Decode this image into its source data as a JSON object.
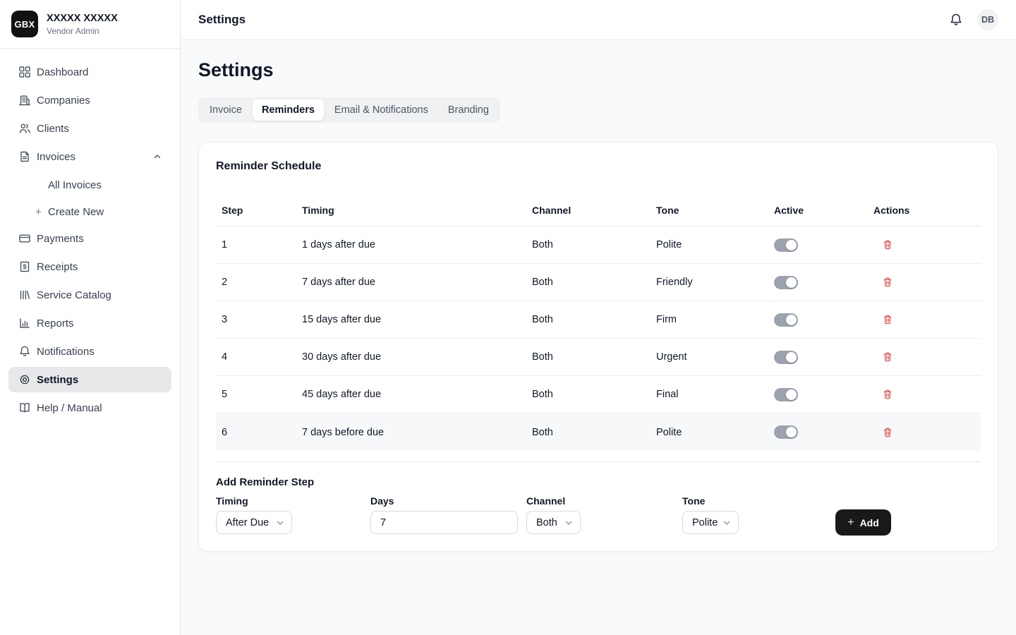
{
  "brand": {
    "logo": "GBX",
    "name": "XXXXX XXXXX",
    "subtitle": "Vendor Admin"
  },
  "topbar": {
    "title": "Settings",
    "avatar_initials": "DB"
  },
  "sidebar": {
    "items": [
      {
        "label": "Dashboard",
        "icon": "dashboard-icon",
        "active": false
      },
      {
        "label": "Companies",
        "icon": "companies-icon",
        "active": false
      },
      {
        "label": "Clients",
        "icon": "clients-icon",
        "active": false
      },
      {
        "label": "Invoices",
        "icon": "invoices-icon",
        "active": false,
        "expanded": true
      },
      {
        "label": "Payments",
        "icon": "payments-icon",
        "active": false
      },
      {
        "label": "Receipts",
        "icon": "receipts-icon",
        "active": false
      },
      {
        "label": "Service Catalog",
        "icon": "service-catalog-icon",
        "active": false
      },
      {
        "label": "Reports",
        "icon": "reports-icon",
        "active": false
      },
      {
        "label": "Notifications",
        "icon": "notifications-icon",
        "active": false
      },
      {
        "label": "Settings",
        "icon": "settings-icon",
        "active": true
      },
      {
        "label": "Help / Manual",
        "icon": "help-icon",
        "active": false
      }
    ],
    "invoices_submenu": [
      "All Invoices",
      "Create New"
    ]
  },
  "page": {
    "title": "Settings"
  },
  "tabs": [
    {
      "label": "Invoice",
      "active": false
    },
    {
      "label": "Reminders",
      "active": true
    },
    {
      "label": "Email & Notifications",
      "active": false
    },
    {
      "label": "Branding",
      "active": false
    }
  ],
  "reminder_schedule": {
    "title": "Reminder Schedule",
    "columns": [
      "Step",
      "Timing",
      "Channel",
      "Tone",
      "Active",
      "Actions"
    ],
    "rows": [
      {
        "step": "1",
        "timing": "1 days after due",
        "channel": "Both",
        "tone": "Polite",
        "active": true,
        "highlighted": false
      },
      {
        "step": "2",
        "timing": "7 days after due",
        "channel": "Both",
        "tone": "Friendly",
        "active": true,
        "highlighted": false
      },
      {
        "step": "3",
        "timing": "15 days after due",
        "channel": "Both",
        "tone": "Firm",
        "active": true,
        "highlighted": false
      },
      {
        "step": "4",
        "timing": "30 days after due",
        "channel": "Both",
        "tone": "Urgent",
        "active": true,
        "highlighted": false
      },
      {
        "step": "5",
        "timing": "45 days after due",
        "channel": "Both",
        "tone": "Final",
        "active": true,
        "highlighted": false
      },
      {
        "step": "6",
        "timing": "7 days before due",
        "channel": "Both",
        "tone": "Polite",
        "active": true,
        "highlighted": true
      }
    ]
  },
  "add_form": {
    "title": "Add Reminder Step",
    "timing": {
      "label": "Timing",
      "value": "After Due"
    },
    "days": {
      "label": "Days",
      "value": "7"
    },
    "channel": {
      "label": "Channel",
      "value": "Both"
    },
    "tone": {
      "label": "Tone",
      "value": "Polite"
    },
    "add_label": "Add"
  },
  "icons": {
    "plus": "+"
  },
  "colors": {
    "danger": "#dc2626",
    "brand_black": "#111111",
    "toggle_track": "#9ca3af",
    "sidebar_active_bg": "#e7e8ea",
    "page_bg": "#f9fafb"
  }
}
